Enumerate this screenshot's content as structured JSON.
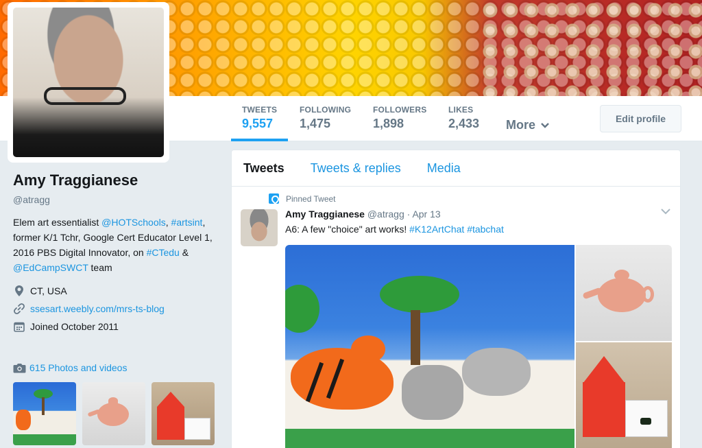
{
  "profile": {
    "name": "Amy Traggianese",
    "handle": "@atragg",
    "bio_parts": [
      "Elem art essentialist ",
      "@HOTSchools",
      ", ",
      "#artsint",
      ", former K/1 Tchr, Google Cert Educator Level 1, 2016 PBS Digital Innovator, on ",
      "#CTedu",
      " & ",
      "@EdCampSWCT",
      " team"
    ],
    "location": "CT, USA",
    "website": "ssesart.weebly.com/mrs-ts-blog",
    "joined": "Joined October 2011",
    "photos_link": "615 Photos and videos"
  },
  "stats": [
    {
      "label": "TWEETS",
      "value": "9,557",
      "active": true
    },
    {
      "label": "FOLLOWING",
      "value": "1,475"
    },
    {
      "label": "FOLLOWERS",
      "value": "1,898"
    },
    {
      "label": "LIKES",
      "value": "2,433"
    }
  ],
  "nav": {
    "more": "More",
    "edit_profile": "Edit profile"
  },
  "tabs": [
    "Tweets",
    "Tweets & replies",
    "Media"
  ],
  "tweet": {
    "pinned_label": "Pinned Tweet",
    "author": "Amy Traggianese",
    "handle": "@atragg",
    "separator": "·",
    "date": "Apr 13",
    "text": "A6: A few \"choice\" art works! ",
    "hashtag1": "#K12ArtChat",
    "hashtag2": "#tabchat"
  },
  "icons": {
    "location": "map-pin-icon",
    "link": "link-icon",
    "calendar": "calendar-icon",
    "camera": "camera-icon",
    "pin": "pin-icon",
    "chevron": "chevron-down-icon"
  },
  "colors": {
    "accent": "#1da1f2",
    "link": "#1b95e0",
    "muted": "#657786",
    "background": "#e6ecf0"
  }
}
